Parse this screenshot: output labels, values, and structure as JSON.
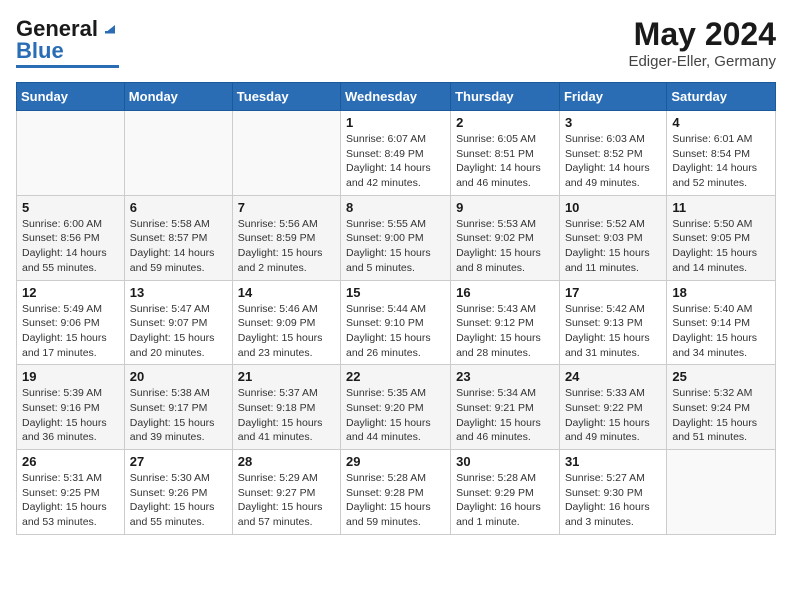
{
  "header": {
    "logo_line1": "General",
    "logo_line2": "Blue",
    "title": "May 2024",
    "subtitle": "Ediger-Eller, Germany"
  },
  "weekdays": [
    "Sunday",
    "Monday",
    "Tuesday",
    "Wednesday",
    "Thursday",
    "Friday",
    "Saturday"
  ],
  "weeks": [
    [
      {
        "day": "",
        "info": ""
      },
      {
        "day": "",
        "info": ""
      },
      {
        "day": "",
        "info": ""
      },
      {
        "day": "1",
        "info": "Sunrise: 6:07 AM\nSunset: 8:49 PM\nDaylight: 14 hours\nand 42 minutes."
      },
      {
        "day": "2",
        "info": "Sunrise: 6:05 AM\nSunset: 8:51 PM\nDaylight: 14 hours\nand 46 minutes."
      },
      {
        "day": "3",
        "info": "Sunrise: 6:03 AM\nSunset: 8:52 PM\nDaylight: 14 hours\nand 49 minutes."
      },
      {
        "day": "4",
        "info": "Sunrise: 6:01 AM\nSunset: 8:54 PM\nDaylight: 14 hours\nand 52 minutes."
      }
    ],
    [
      {
        "day": "5",
        "info": "Sunrise: 6:00 AM\nSunset: 8:56 PM\nDaylight: 14 hours\nand 55 minutes."
      },
      {
        "day": "6",
        "info": "Sunrise: 5:58 AM\nSunset: 8:57 PM\nDaylight: 14 hours\nand 59 minutes."
      },
      {
        "day": "7",
        "info": "Sunrise: 5:56 AM\nSunset: 8:59 PM\nDaylight: 15 hours\nand 2 minutes."
      },
      {
        "day": "8",
        "info": "Sunrise: 5:55 AM\nSunset: 9:00 PM\nDaylight: 15 hours\nand 5 minutes."
      },
      {
        "day": "9",
        "info": "Sunrise: 5:53 AM\nSunset: 9:02 PM\nDaylight: 15 hours\nand 8 minutes."
      },
      {
        "day": "10",
        "info": "Sunrise: 5:52 AM\nSunset: 9:03 PM\nDaylight: 15 hours\nand 11 minutes."
      },
      {
        "day": "11",
        "info": "Sunrise: 5:50 AM\nSunset: 9:05 PM\nDaylight: 15 hours\nand 14 minutes."
      }
    ],
    [
      {
        "day": "12",
        "info": "Sunrise: 5:49 AM\nSunset: 9:06 PM\nDaylight: 15 hours\nand 17 minutes."
      },
      {
        "day": "13",
        "info": "Sunrise: 5:47 AM\nSunset: 9:07 PM\nDaylight: 15 hours\nand 20 minutes."
      },
      {
        "day": "14",
        "info": "Sunrise: 5:46 AM\nSunset: 9:09 PM\nDaylight: 15 hours\nand 23 minutes."
      },
      {
        "day": "15",
        "info": "Sunrise: 5:44 AM\nSunset: 9:10 PM\nDaylight: 15 hours\nand 26 minutes."
      },
      {
        "day": "16",
        "info": "Sunrise: 5:43 AM\nSunset: 9:12 PM\nDaylight: 15 hours\nand 28 minutes."
      },
      {
        "day": "17",
        "info": "Sunrise: 5:42 AM\nSunset: 9:13 PM\nDaylight: 15 hours\nand 31 minutes."
      },
      {
        "day": "18",
        "info": "Sunrise: 5:40 AM\nSunset: 9:14 PM\nDaylight: 15 hours\nand 34 minutes."
      }
    ],
    [
      {
        "day": "19",
        "info": "Sunrise: 5:39 AM\nSunset: 9:16 PM\nDaylight: 15 hours\nand 36 minutes."
      },
      {
        "day": "20",
        "info": "Sunrise: 5:38 AM\nSunset: 9:17 PM\nDaylight: 15 hours\nand 39 minutes."
      },
      {
        "day": "21",
        "info": "Sunrise: 5:37 AM\nSunset: 9:18 PM\nDaylight: 15 hours\nand 41 minutes."
      },
      {
        "day": "22",
        "info": "Sunrise: 5:35 AM\nSunset: 9:20 PM\nDaylight: 15 hours\nand 44 minutes."
      },
      {
        "day": "23",
        "info": "Sunrise: 5:34 AM\nSunset: 9:21 PM\nDaylight: 15 hours\nand 46 minutes."
      },
      {
        "day": "24",
        "info": "Sunrise: 5:33 AM\nSunset: 9:22 PM\nDaylight: 15 hours\nand 49 minutes."
      },
      {
        "day": "25",
        "info": "Sunrise: 5:32 AM\nSunset: 9:24 PM\nDaylight: 15 hours\nand 51 minutes."
      }
    ],
    [
      {
        "day": "26",
        "info": "Sunrise: 5:31 AM\nSunset: 9:25 PM\nDaylight: 15 hours\nand 53 minutes."
      },
      {
        "day": "27",
        "info": "Sunrise: 5:30 AM\nSunset: 9:26 PM\nDaylight: 15 hours\nand 55 minutes."
      },
      {
        "day": "28",
        "info": "Sunrise: 5:29 AM\nSunset: 9:27 PM\nDaylight: 15 hours\nand 57 minutes."
      },
      {
        "day": "29",
        "info": "Sunrise: 5:28 AM\nSunset: 9:28 PM\nDaylight: 15 hours\nand 59 minutes."
      },
      {
        "day": "30",
        "info": "Sunrise: 5:28 AM\nSunset: 9:29 PM\nDaylight: 16 hours\nand 1 minute."
      },
      {
        "day": "31",
        "info": "Sunrise: 5:27 AM\nSunset: 9:30 PM\nDaylight: 16 hours\nand 3 minutes."
      },
      {
        "day": "",
        "info": ""
      }
    ]
  ]
}
